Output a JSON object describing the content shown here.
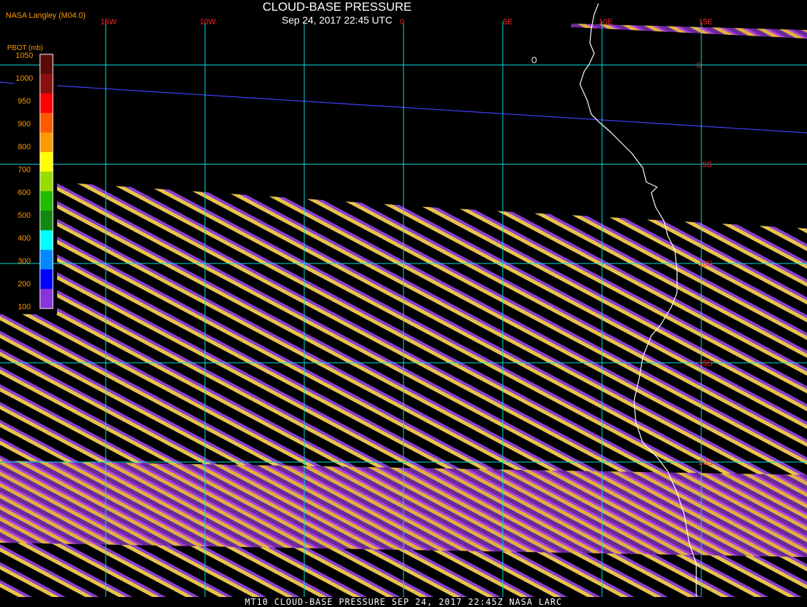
{
  "header": {
    "title": "CLOUD-BASE PRESSURE",
    "subtitle": "Sep 24, 2017 22:45 UTC",
    "producer": "NASA Langley (M04.0)"
  },
  "footer": {
    "text": "MT10  CLOUD-BASE PRESSURE  SEP 24, 2017 22:45Z  NASA LARC"
  },
  "colorbar": {
    "label": "PBOT (mb)",
    "ticks": [
      "1050",
      "1000",
      "950",
      "900",
      "800",
      "700",
      "600",
      "500",
      "400",
      "300",
      "200",
      "100"
    ],
    "colors": [
      "#5a0a0a",
      "#8a1010",
      "#ff0000",
      "#ff5a00",
      "#ff9900",
      "#ffff00",
      "#99dd00",
      "#22bb00",
      "#118811",
      "#00ffff",
      "#0088ff",
      "#0000ff",
      "#8833dd"
    ]
  },
  "longitude_labels": [
    "15W",
    "10W",
    "0",
    "5E",
    "10E",
    "15E"
  ],
  "latitude_labels": [
    "0",
    "5S",
    "10S",
    "15S",
    "20S"
  ],
  "colors": {
    "grid": "#00e0e0",
    "coast": "#ffffff",
    "equator": "#4040ff",
    "grid_label": "#ff2020",
    "swath_a": "#ffd24a",
    "swath_b": "#8a40d0",
    "swath_c": "#4466ff"
  }
}
